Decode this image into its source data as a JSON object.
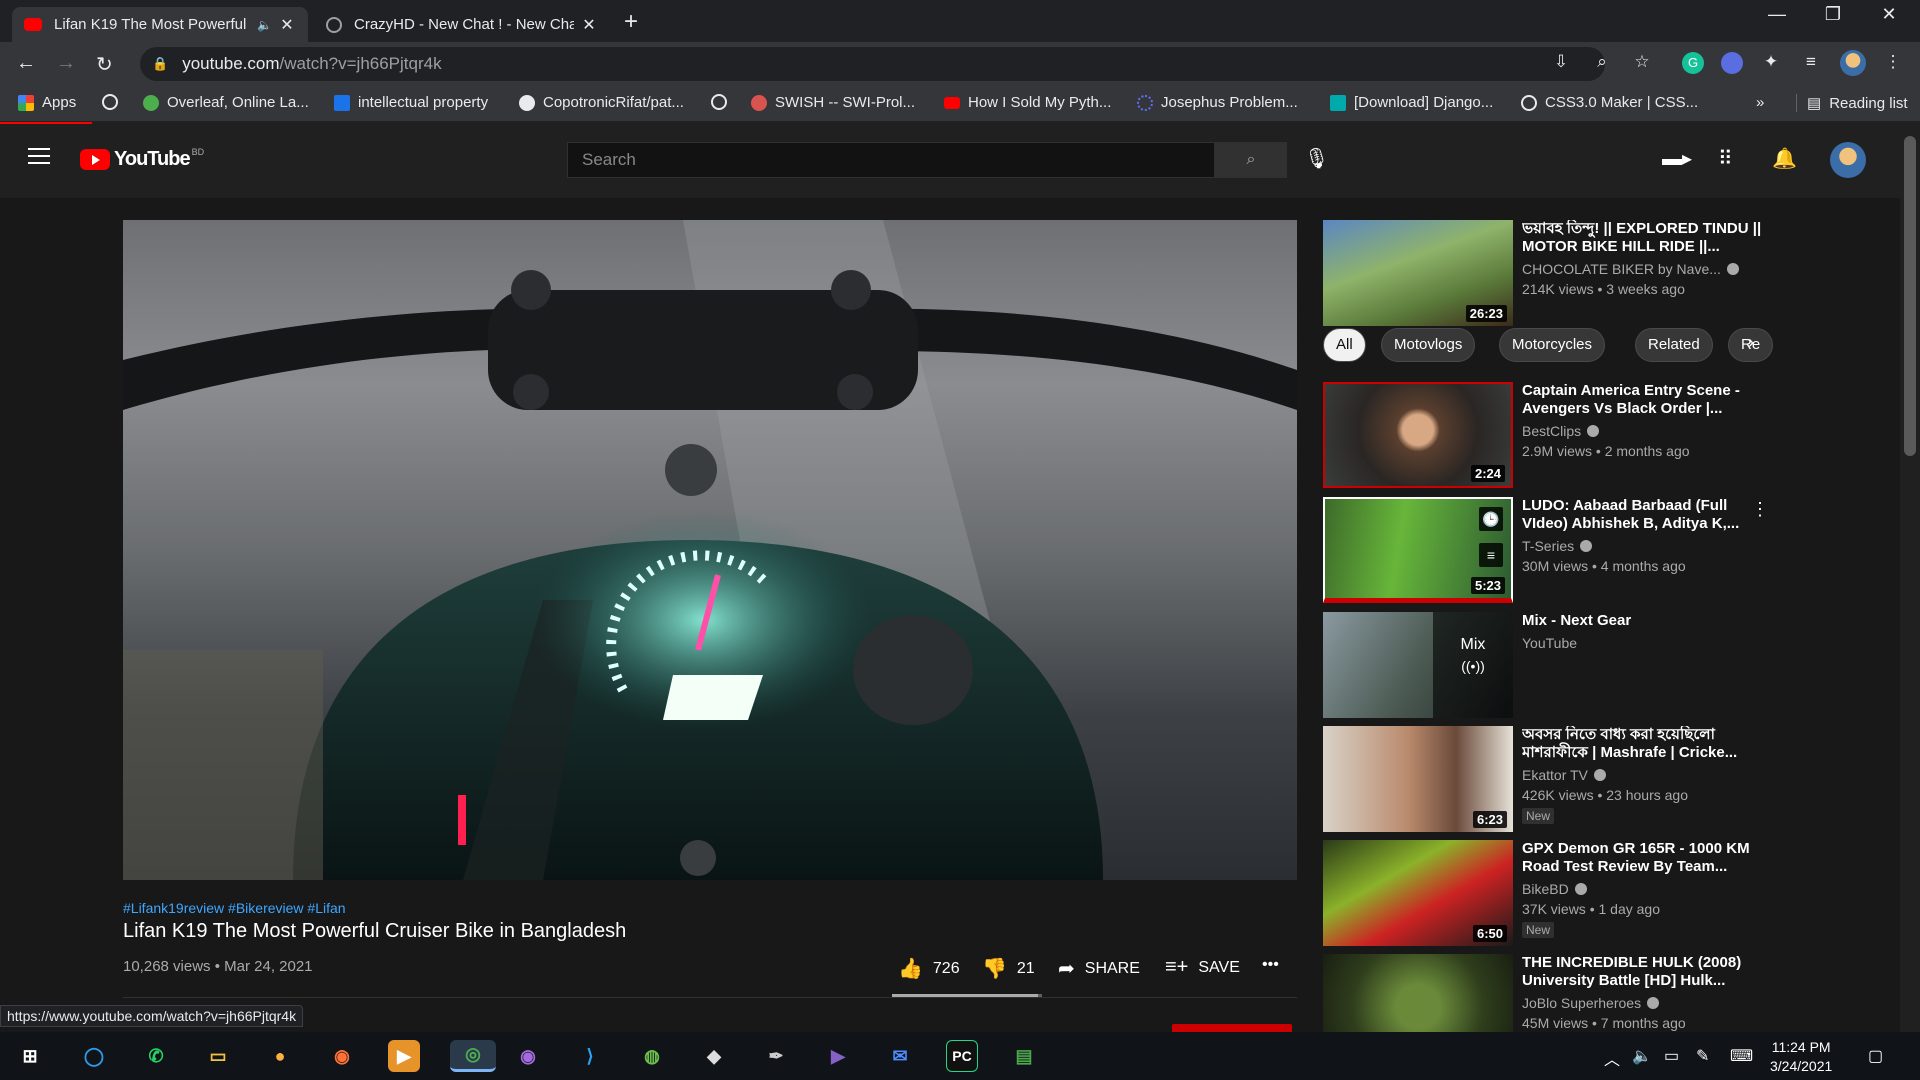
{
  "browser": {
    "tabs": [
      {
        "title": "Lifan K19 The Most Powerful",
        "active": true,
        "favicon": "youtube-favicon"
      },
      {
        "title": "CrazyHD - New Chat ! - New Cha",
        "active": false,
        "favicon": "globe-favicon"
      }
    ],
    "new_tab": "+",
    "window": {
      "minimize": "—",
      "restore": "❐",
      "close": "✕"
    },
    "url_host": "youtube.com",
    "url_path": "/watch?v=jh66Pjtqr4k",
    "bookmarks": [
      {
        "label": "Apps",
        "color": "#ea4335"
      },
      {
        "label": "",
        "color": "#e8eaed"
      },
      {
        "label": "Overleaf, Online La...",
        "color": "#4cae4c"
      },
      {
        "label": "intellectual property",
        "color": "#1a73e8"
      },
      {
        "label": "CopotronicRifat/pat...",
        "color": "#e8eaed"
      },
      {
        "label": "",
        "color": "#e8eaed"
      },
      {
        "label": "SWISH -- SWI-Prol...",
        "color": "#d9534f"
      },
      {
        "label": "How I Sold My Pyth...",
        "color": "#ff0000"
      },
      {
        "label": "Josephus Problem...",
        "color": "#5f6fff"
      },
      {
        "label": "[Download] Django...",
        "color": "#0aa"
      },
      {
        "label": "CSS3.0 Maker | CSS...",
        "color": "#e8eaed"
      }
    ],
    "bookmarks_overflow": "»",
    "reading_list": "Reading list",
    "status_url": "https://www.youtube.com/watch?v=jh66Pjtqr4k"
  },
  "youtube": {
    "logo_text": "YouTube",
    "country": "BD",
    "search_placeholder": "Search",
    "video": {
      "hashtags": "#Lifank19review #Bikereview #Lifan",
      "title": "Lifan K19 The Most Powerful Cruiser Bike in Bangladesh",
      "meta": "10,268 views • Mar 24, 2021",
      "likes": "726",
      "dislikes": "21",
      "share": "SHARE",
      "save": "SAVE",
      "like_ratio": 0.972
    },
    "chips": [
      "All",
      "Motovlogs",
      "Motorcycles",
      "Related",
      "Re"
    ],
    "related": [
      {
        "title": "ভয়াবহ তিন্দু! || EXPLORED TINDU || MOTOR BIKE HILL RIDE ||...",
        "channel": "CHOCOLATE BIKER by Nave...",
        "views": "214K views • 3 weeks ago",
        "duration": "26:23",
        "badge": ""
      },
      {
        "title": "Captain America Entry Scene - Avengers Vs Black Order |...",
        "channel": "BestClips",
        "views": "2.9M views • 2 months ago",
        "duration": "2:24",
        "badge": ""
      },
      {
        "title": "LUDO: Aabaad Barbaad (Full VIdeo) Abhishek B, Aditya K,...",
        "channel": "T-Series",
        "views": "30M views • 4 months ago",
        "duration": "5:23",
        "badge": ""
      },
      {
        "title": "Mix - Next Gear",
        "channel": "YouTube",
        "views": "",
        "duration": "",
        "badge": "",
        "mix_label": "Mix"
      },
      {
        "title": "অবসর নিতে বাধ্য করা হয়েছিলো মাশরাফীকে | Mashrafe | Cricke...",
        "channel": "Ekattor TV",
        "views": "426K views • 23 hours ago",
        "duration": "6:23",
        "badge": "New"
      },
      {
        "title": "GPX Demon GR 165R - 1000 KM Road Test Review By Team...",
        "channel": "BikeBD",
        "views": "37K views • 1 day ago",
        "duration": "6:50",
        "badge": "New"
      },
      {
        "title": "THE INCREDIBLE HULK (2008) University Battle [HD] Hulk...",
        "channel": "JoBlo Superheroes",
        "views": "45M views • 7 months ago",
        "duration": "",
        "badge": ""
      }
    ]
  },
  "taskbar": {
    "time": "11:24 PM",
    "date": "3/24/2021"
  }
}
